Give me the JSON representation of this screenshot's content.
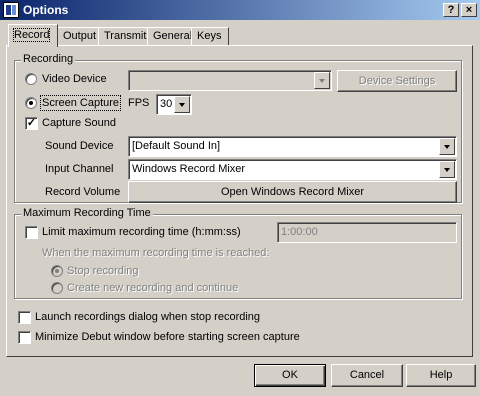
{
  "window": {
    "title": "Options",
    "help_glyph": "?",
    "close_glyph": "×"
  },
  "tabs": [
    {
      "label": "Record",
      "active": true
    },
    {
      "label": "Output"
    },
    {
      "label": "Transmit"
    },
    {
      "label": "General"
    },
    {
      "label": "Keys"
    }
  ],
  "recording": {
    "group_label": "Recording",
    "video_device_label": "Video Device",
    "video_device_value": "",
    "device_settings_label": "Device Settings",
    "screen_capture_label": "Screen Capture",
    "screen_capture_selected": true,
    "fps_label": "FPS",
    "fps_value": "30",
    "capture_sound_label": "Capture Sound",
    "capture_sound_checked": true,
    "check_mark": "✓",
    "sound_device_label": "Sound Device",
    "sound_device_value": "[Default Sound In]",
    "input_channel_label": "Input Channel",
    "input_channel_value": "Windows Record Mixer",
    "record_volume_label": "Record Volume",
    "open_mixer_label": "Open Windows Record Mixer"
  },
  "max_time": {
    "group_label": "Maximum Recording Time",
    "limit_label": "Limit maximum recording time (h:mm:ss)",
    "limit_checked": false,
    "time_value": "1:00:00",
    "when_reached_label": "When the maximum recording time is reached:",
    "stop_recording_label": "Stop recording",
    "create_new_label": "Create new recording and continue"
  },
  "options": {
    "launch_dialog_label": "Launch recordings dialog when stop recording",
    "minimize_label": "Minimize Debut window before starting screen capture"
  },
  "footer": {
    "ok_label": "OK",
    "cancel_label": "Cancel",
    "help_label": "Help"
  }
}
